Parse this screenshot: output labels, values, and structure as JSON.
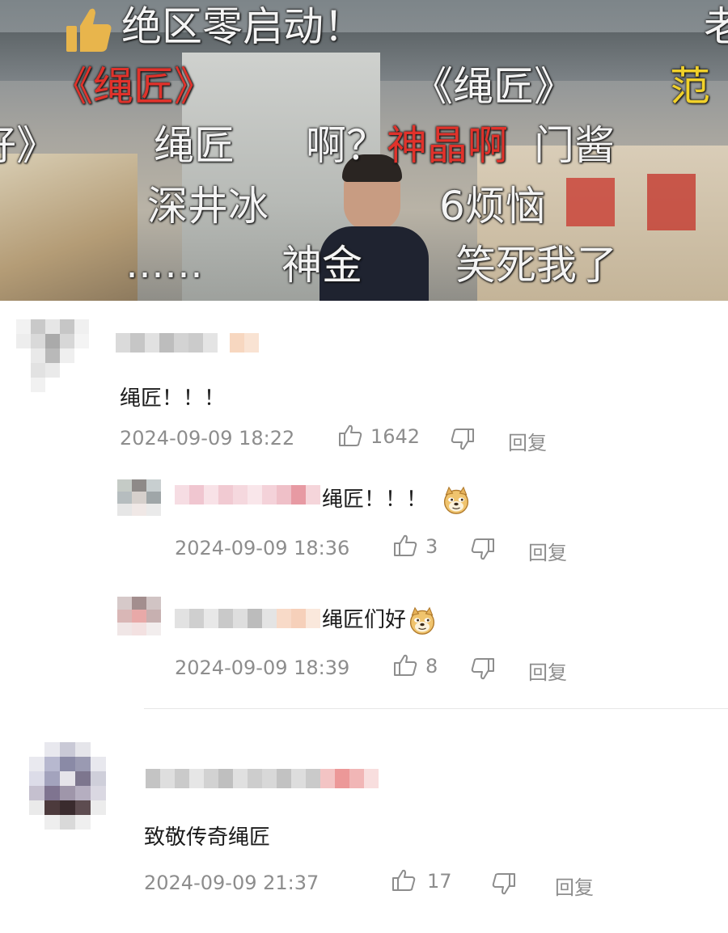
{
  "danmaku": [
    {
      "text": "绝区零启动！",
      "color": "white"
    },
    {
      "text": "老",
      "color": "white"
    },
    {
      "text": "《绳匠》",
      "color": "red"
    },
    {
      "text": "《绳匠》",
      "color": "white"
    },
    {
      "text": "范",
      "color": "yellow"
    },
    {
      "text": "好》",
      "color": "white"
    },
    {
      "text": "绳匠",
      "color": "white"
    },
    {
      "text": "啊？",
      "color": "white"
    },
    {
      "text": "神晶啊",
      "color": "red"
    },
    {
      "text": "门酱",
      "color": "white"
    },
    {
      "text": "深井冰",
      "color": "white"
    },
    {
      "text": "6烦恼",
      "color": "white"
    },
    {
      "text": "……",
      "color": "white"
    },
    {
      "text": "神金",
      "color": "white"
    },
    {
      "text": "笑死我了",
      "color": "white"
    }
  ],
  "comments": [
    {
      "text": "绳匠！！！",
      "time": "2024-09-09 18:22",
      "likes": "1642",
      "reply_label": "回复",
      "replies": [
        {
          "text": "绳匠！！！",
          "emoji": "doge",
          "time": "2024-09-09 18:36",
          "likes": "3",
          "reply_label": "回复"
        },
        {
          "text": "绳匠们好",
          "emoji": "doge",
          "time": "2024-09-09 18:39",
          "likes": "8",
          "reply_label": "回复"
        }
      ]
    },
    {
      "text": "致敬传奇绳匠",
      "time": "2024-09-09 21:37",
      "likes": "17",
      "reply_label": "回复",
      "replies": []
    }
  ],
  "colors": {
    "danmaku_red": "#e0322b",
    "danmaku_yellow": "#f1d12a",
    "meta_gray": "#8d8d8d",
    "thumb_yellow": "#e8b54c"
  }
}
